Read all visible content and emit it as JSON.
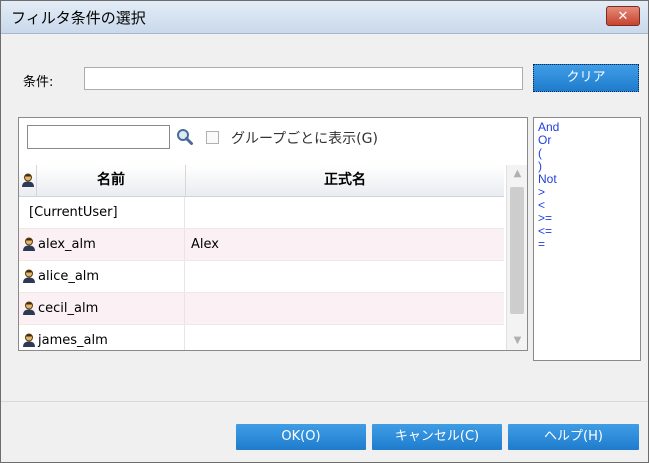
{
  "window": {
    "title": "フィルタ条件の選択",
    "close_glyph": "✕"
  },
  "condition": {
    "label": "条件:",
    "value": "",
    "clear_button": "クリア"
  },
  "grid": {
    "search_value": "",
    "group_label": "グループごとに表示(G)",
    "columns": {
      "name": "名前",
      "formal": "正式名"
    },
    "rows": [
      {
        "name": "[CurrentUser]",
        "formal": "",
        "icon": "none"
      },
      {
        "name": "alex_alm",
        "formal": "Alex",
        "icon": "user-icon"
      },
      {
        "name": "alice_alm",
        "formal": "",
        "icon": "user-icon"
      },
      {
        "name": "cecil_alm",
        "formal": "",
        "icon": "user-icon"
      },
      {
        "name": "james_alm",
        "formal": "",
        "icon": "user-icon"
      }
    ]
  },
  "operators": [
    "And",
    "Or",
    "(",
    ")",
    "Not",
    ">",
    "<",
    ">=",
    "<=",
    "="
  ],
  "buttons": {
    "ok": "OK(O)",
    "cancel": "キャンセル(C)",
    "help": "ヘルプ(H)"
  },
  "colors": {
    "accent": "#2a8ada",
    "operator_text": "#1f3fe0",
    "alt_row": "#fbf1f5"
  }
}
